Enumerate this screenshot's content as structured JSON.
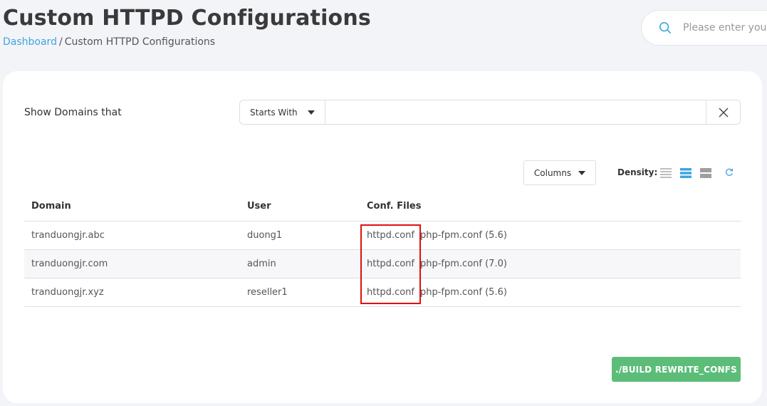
{
  "header": {
    "title": "Custom HTTPD Configurations",
    "breadcrumb": {
      "home": "Dashboard",
      "separator": "/",
      "current": "Custom HTTPD Configurations"
    }
  },
  "search": {
    "placeholder": "Please enter you"
  },
  "filter": {
    "label": "Show Domains that",
    "mode": "Starts With",
    "value": ""
  },
  "toolbar": {
    "columns_label": "Columns",
    "density_label": "Density:",
    "density_selected": "medium"
  },
  "table": {
    "headers": {
      "domain": "Domain",
      "user": "User",
      "conf": "Conf. Files"
    },
    "rows": [
      {
        "domain": "tranduongjr.abc",
        "user": "duong1",
        "httpd": "httpd.conf",
        "fpm": "php-fpm.conf (5.6)"
      },
      {
        "domain": "tranduongjr.com",
        "user": "admin",
        "httpd": "httpd.conf",
        "fpm": "php-fpm.conf (7.0)"
      },
      {
        "domain": "tranduongjr.xyz",
        "user": "reseller1",
        "httpd": "httpd.conf",
        "fpm": "php-fpm.conf (5.6)"
      }
    ]
  },
  "actions": {
    "build_label": "./BUILD REWRITE_CONFS"
  },
  "colors": {
    "accent": "#3fa4e0",
    "success": "#5cbd79",
    "highlight": "#e01010"
  }
}
